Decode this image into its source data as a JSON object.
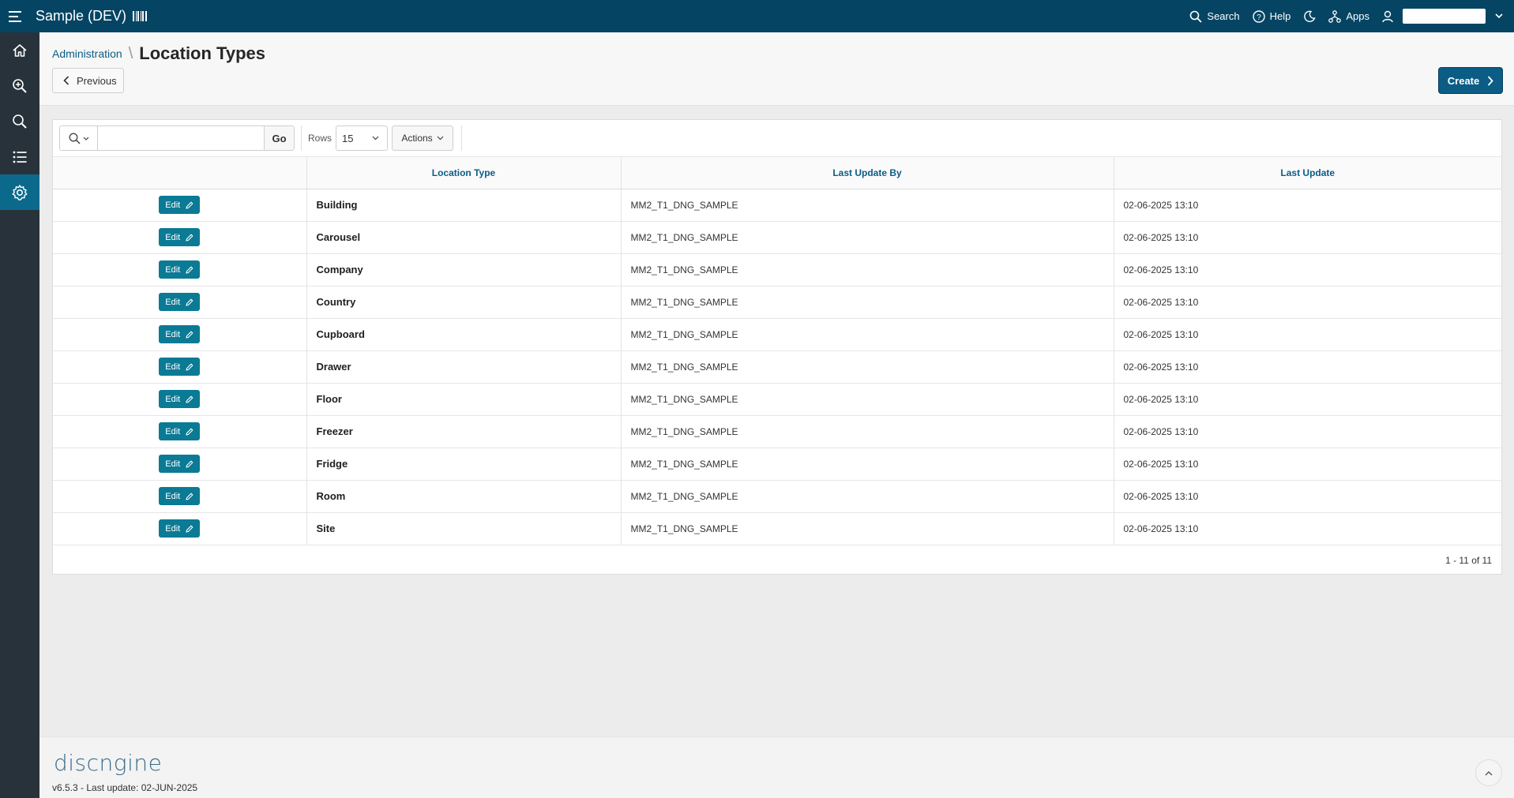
{
  "header": {
    "app_title": "Sample (DEV)",
    "nav": [
      {
        "label": "Search",
        "icon": "search-icon"
      },
      {
        "label": "Help",
        "icon": "help-icon"
      },
      {
        "label": "",
        "icon": "dark-mode-icon"
      },
      {
        "label": "Apps",
        "icon": "apps-icon"
      }
    ]
  },
  "sidebar": {
    "items": [
      {
        "icon": "home-icon",
        "active": false
      },
      {
        "icon": "zoom-in-icon",
        "active": false
      },
      {
        "icon": "search-icon",
        "active": false
      },
      {
        "icon": "list-icon",
        "active": false
      },
      {
        "icon": "gear-icon",
        "active": true
      }
    ]
  },
  "page": {
    "breadcrumb_parent": "Administration",
    "title": "Location Types",
    "previous_label": "Previous",
    "create_label": "Create"
  },
  "toolbar": {
    "search_value": "",
    "go_label": "Go",
    "rows_label": "Rows",
    "rows_value": "15",
    "actions_label": "Actions"
  },
  "table": {
    "columns": [
      "",
      "Location Type",
      "Last Update By",
      "Last Update"
    ],
    "edit_label": "Edit",
    "rows": [
      {
        "type": "Building",
        "by": "MM2_T1_DNG_SAMPLE",
        "updated": "02-06-2025 13:10"
      },
      {
        "type": "Carousel",
        "by": "MM2_T1_DNG_SAMPLE",
        "updated": "02-06-2025 13:10"
      },
      {
        "type": "Company",
        "by": "MM2_T1_DNG_SAMPLE",
        "updated": "02-06-2025 13:10"
      },
      {
        "type": "Country",
        "by": "MM2_T1_DNG_SAMPLE",
        "updated": "02-06-2025 13:10"
      },
      {
        "type": "Cupboard",
        "by": "MM2_T1_DNG_SAMPLE",
        "updated": "02-06-2025 13:10"
      },
      {
        "type": "Drawer",
        "by": "MM2_T1_DNG_SAMPLE",
        "updated": "02-06-2025 13:10"
      },
      {
        "type": "Floor",
        "by": "MM2_T1_DNG_SAMPLE",
        "updated": "02-06-2025 13:10"
      },
      {
        "type": "Freezer",
        "by": "MM2_T1_DNG_SAMPLE",
        "updated": "02-06-2025 13:10"
      },
      {
        "type": "Fridge",
        "by": "MM2_T1_DNG_SAMPLE",
        "updated": "02-06-2025 13:10"
      },
      {
        "type": "Room",
        "by": "MM2_T1_DNG_SAMPLE",
        "updated": "02-06-2025 13:10"
      },
      {
        "type": "Site",
        "by": "MM2_T1_DNG_SAMPLE",
        "updated": "02-06-2025 13:10"
      }
    ],
    "pagination": "1 - 11 of 11"
  },
  "footer": {
    "logo_text": "discngine",
    "version": "v6.5.3 - Last update: 02-JUN-2025"
  },
  "colors": {
    "header_bg": "#054563",
    "sidebar_bg": "#28323b",
    "sidebar_active": "#0b6a8c",
    "primary": "#0b5d85",
    "edit_button": "#0b7a95"
  }
}
